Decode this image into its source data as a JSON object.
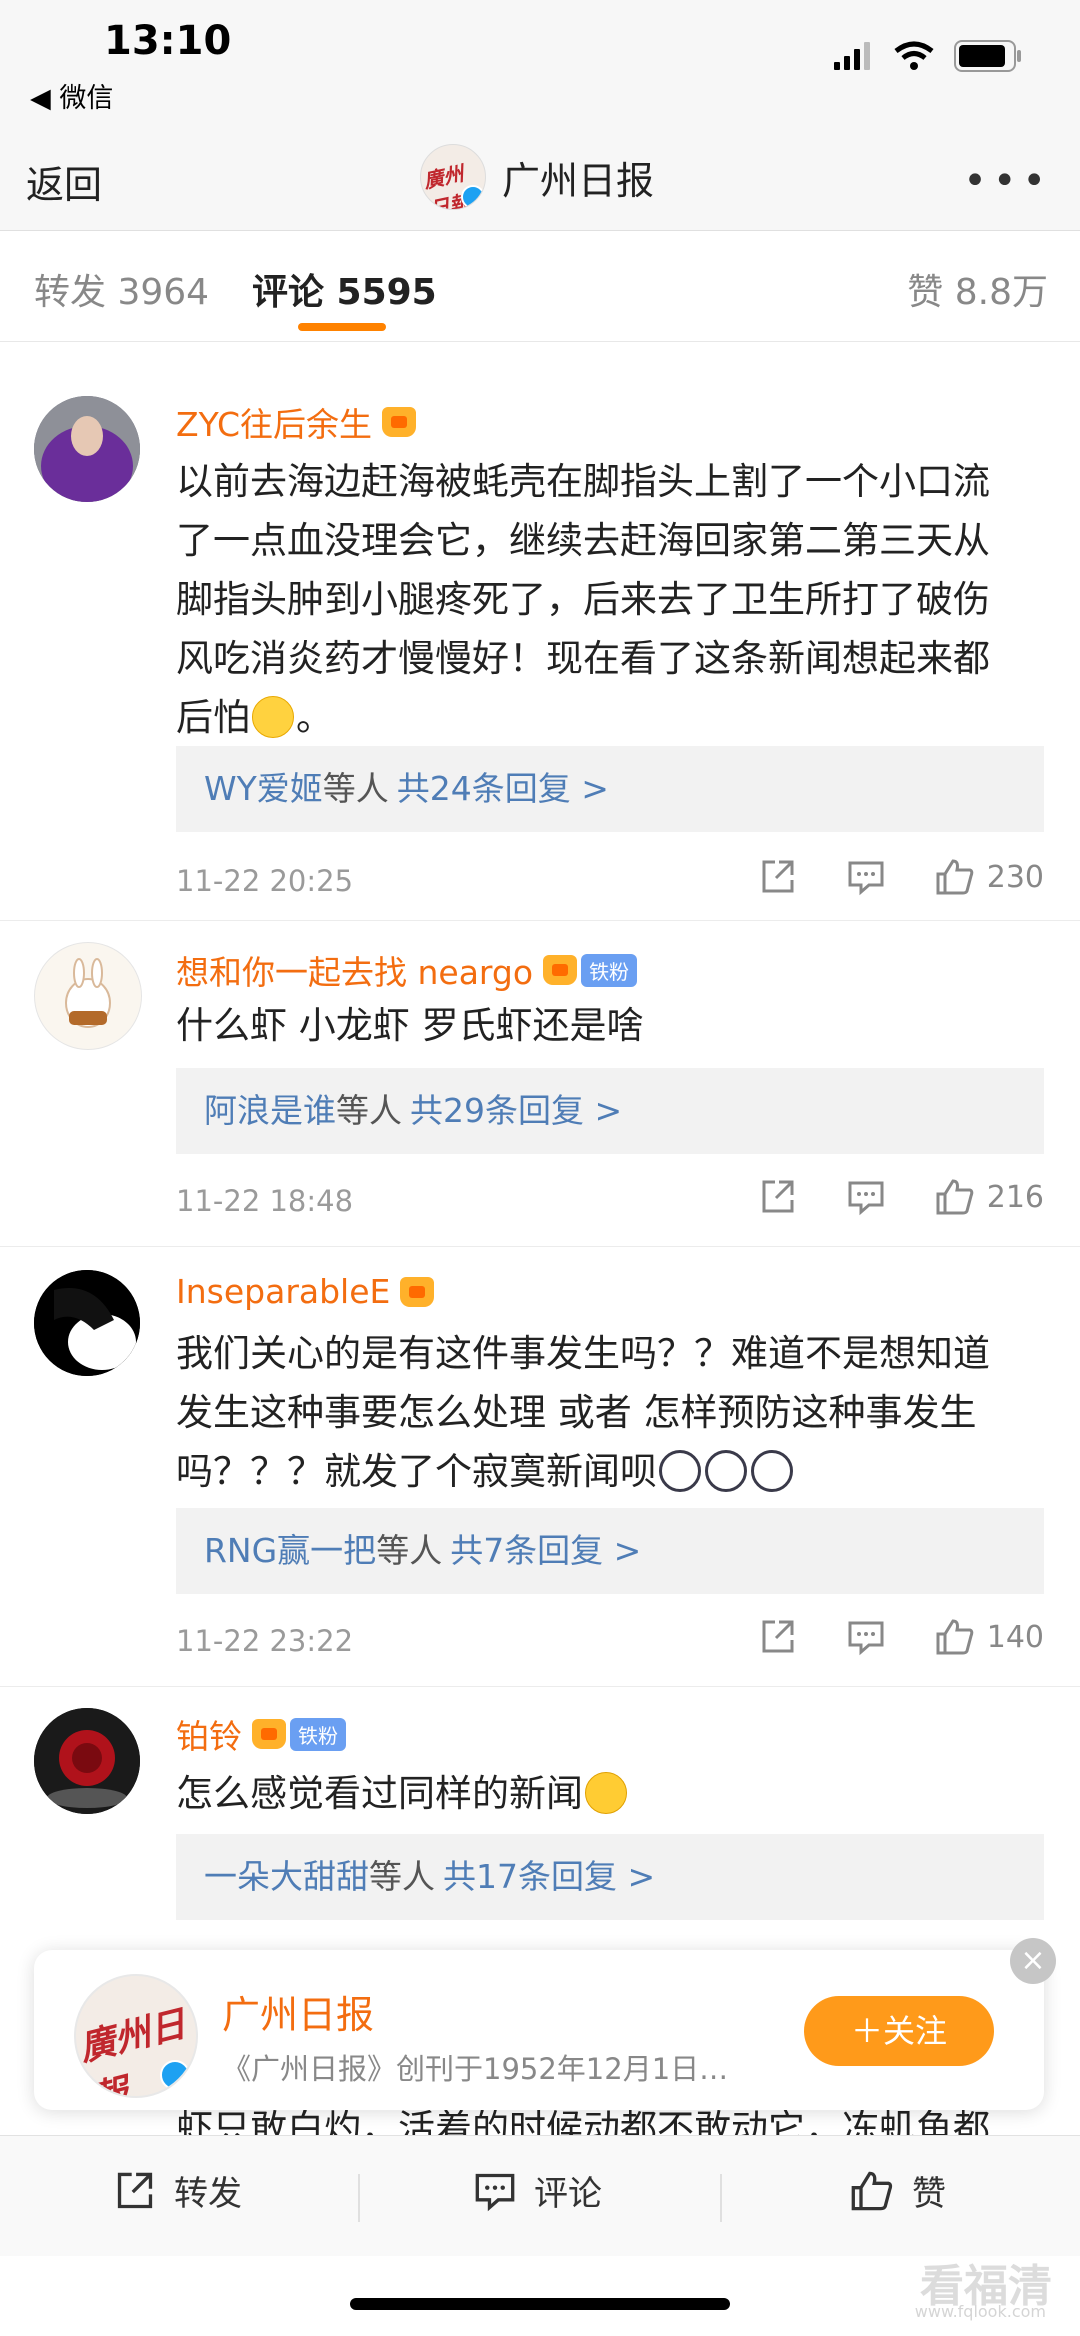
{
  "status_bar": {
    "time": "13:10",
    "back_app": "◀ 微信"
  },
  "nav": {
    "back": "返回",
    "title": "广州日报",
    "avatar_text": "廣州日報"
  },
  "tabs": {
    "repost": "转发 3964",
    "comment": "评论 5595",
    "like": "赞 8.8万"
  },
  "comments": [
    {
      "name": "ZYC往后余生",
      "text_lines": [
        "以前去海边赶海被蚝壳在脚指头上割了一个小口流",
        "了一点血没理会它，继续去赶海回家第二第三天从",
        "脚指头肿到小腿疼死了，后来去了卫生所打了破伤",
        "风吃消炎药才慢慢好！现在看了这条新闻想起来都"
      ],
      "text_last": "后怕",
      "text_end": "。",
      "reply_user": "WY爱姬",
      "reply_etc": "等人",
      "reply_total": "共24条回复 >",
      "time": "11-22 20:25",
      "likes": "230"
    },
    {
      "name": "想和你一起去找 neargo",
      "badge": "铁粉",
      "text": "什么虾 小龙虾 罗氏虾还是啥",
      "reply_user": "阿浪是谁",
      "reply_etc": "等人",
      "reply_total": "共29条回复 >",
      "time": "11-22 18:48",
      "likes": "216"
    },
    {
      "name": "InseparableE",
      "text_lines": [
        "我们关心的是有这件事发生吗？？难道不是想知道",
        "发生这种事要怎么处理 或者 怎样预防这种事发生"
      ],
      "text_last": "吗？？？就发了个寂寞新闻呗",
      "reply_user": "RNG赢一把",
      "reply_etc": "等人",
      "reply_total": "共7条回复 >",
      "time": "11-22 23:22",
      "likes": "140"
    },
    {
      "name": "铂铃",
      "badge": "铁粉",
      "text": "怎么感觉看过同样的新闻",
      "reply_user": "一朵大甜甜",
      "reply_etc": "等人",
      "reply_total": "共17条回复 >"
    }
  ],
  "follow_card": {
    "name": "广州日报",
    "desc": "《广州日报》创刊于1952年12月1日…",
    "follow": "＋关注",
    "close": "×",
    "avatar_text": "廣州日報"
  },
  "partial_comment": "虾只敢白灼，活着的时候动都不敢动它，冻虮鱼都",
  "bottom_bar": {
    "repost": "转发",
    "comment": "评论",
    "like": "赞"
  },
  "watermark": {
    "main": "看福清",
    "sub": "www.fqlook.com"
  },
  "colors": {
    "accent": "#ff8200",
    "name": "#f36d10",
    "link": "#4f7db6",
    "verified": "#1da1f2"
  },
  "icons": [
    "signal-icon",
    "wifi-icon",
    "battery-icon",
    "more-icon",
    "share-icon",
    "comment-icon",
    "like-icon",
    "crown-icon",
    "close-icon"
  ]
}
